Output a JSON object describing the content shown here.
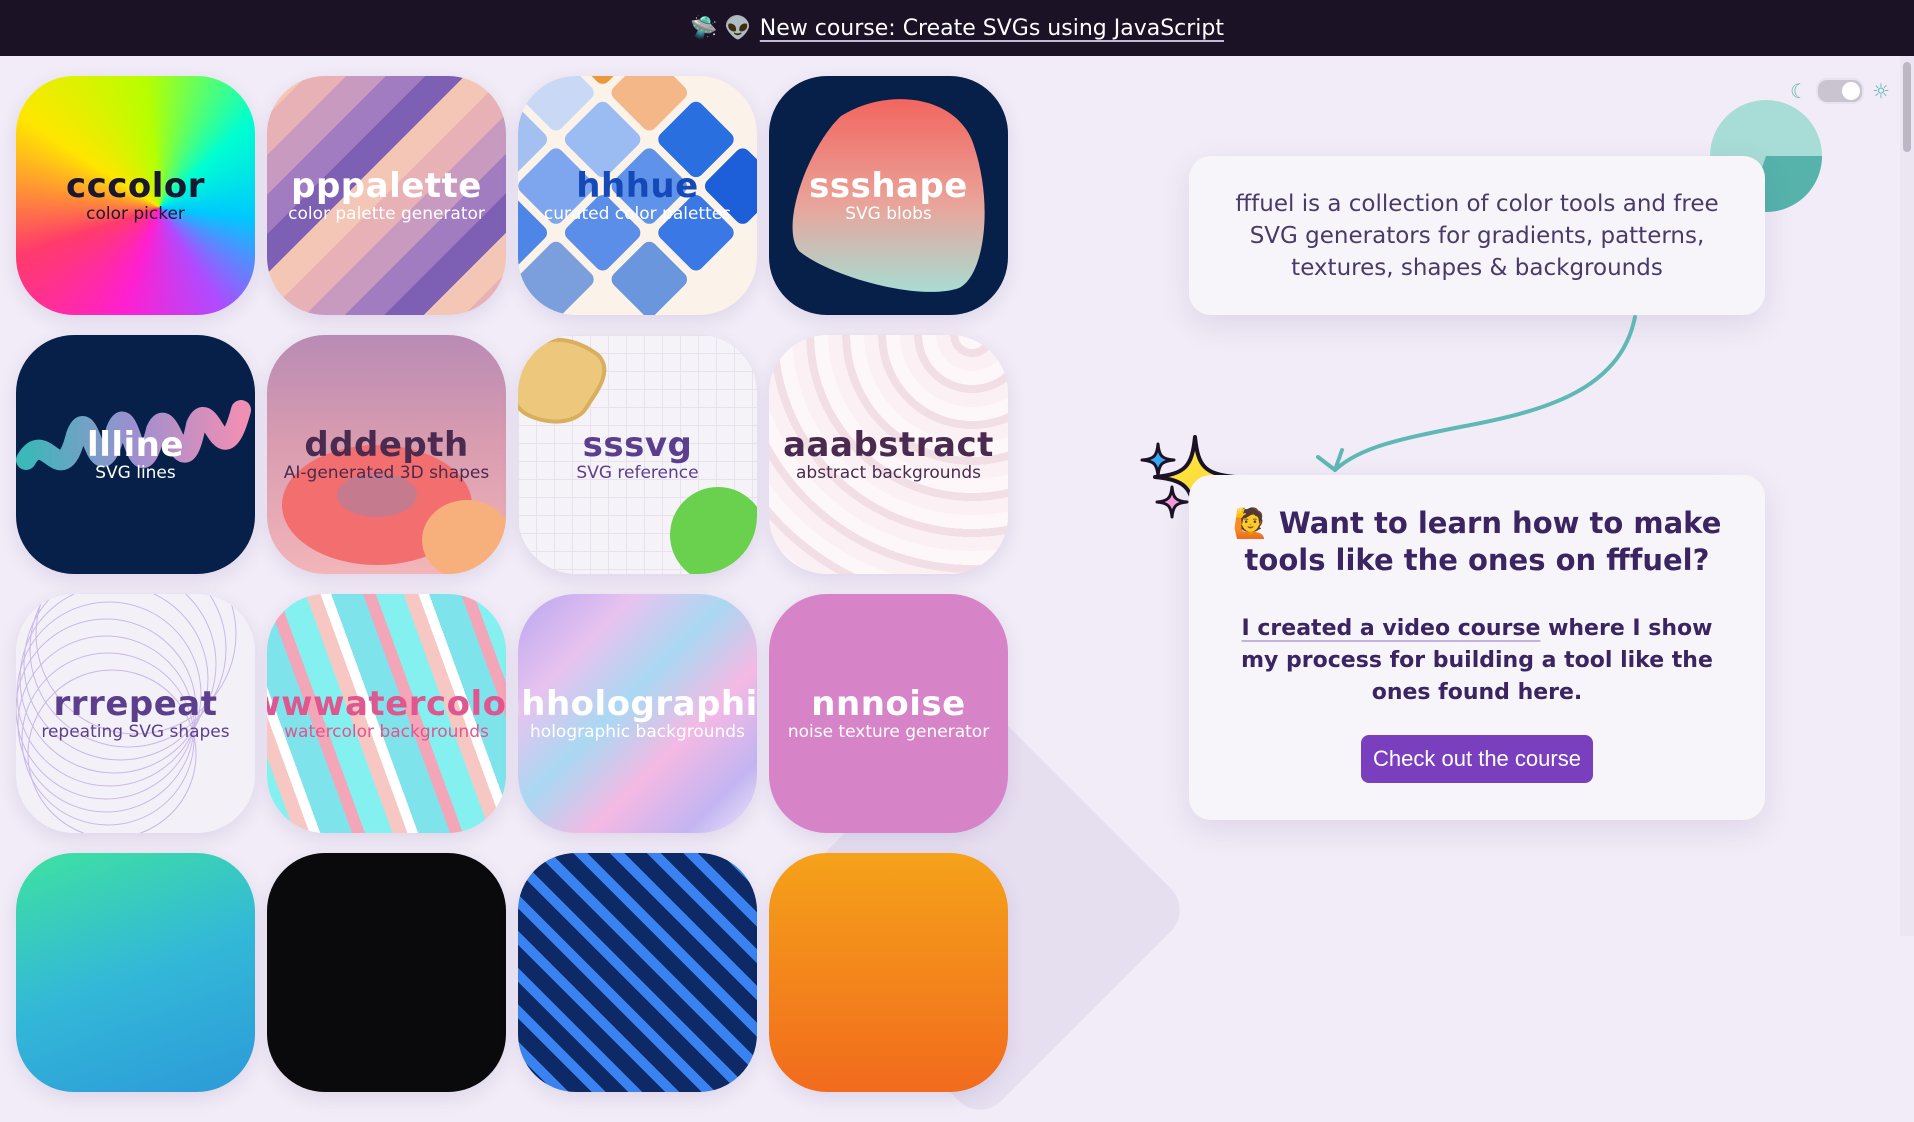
{
  "banner": {
    "emoji": "🛸 👽",
    "link": "New course: Create SVGs using JavaScript"
  },
  "theme_toggle": {
    "moon_icon": "☾",
    "sun_icon": "☼",
    "state": "dark-off"
  },
  "tiles": [
    {
      "name": "cccolor",
      "sub": "color picker"
    },
    {
      "name": "pppalette",
      "sub": "color palette generator"
    },
    {
      "name": "hhhue",
      "sub": "curated color palettes"
    },
    {
      "name": "ssshape",
      "sub": "SVG blobs"
    },
    {
      "name": "llline",
      "sub": "SVG lines"
    },
    {
      "name": "dddepth",
      "sub": "AI-generated 3D shapes"
    },
    {
      "name": "sssvg",
      "sub": "SVG reference"
    },
    {
      "name": "aaabstract",
      "sub": "abstract backgrounds"
    },
    {
      "name": "rrrepeat",
      "sub": "repeating SVG shapes"
    },
    {
      "name": "wwwatercolor",
      "sub": "watercolor backgrounds"
    },
    {
      "name": "hhholographic",
      "sub": "holographic backgrounds"
    },
    {
      "name": "nnnoise",
      "sub": "noise texture generator"
    },
    {
      "name": "",
      "sub": ""
    },
    {
      "name": "",
      "sub": ""
    },
    {
      "name": "",
      "sub": ""
    },
    {
      "name": "",
      "sub": ""
    }
  ],
  "intro": {
    "text": "fffuel is a collection of color tools and free SVG generators for gradients, patterns, textures, shapes & backgrounds"
  },
  "course": {
    "emoji": "🙋",
    "heading": "Want to learn how to make tools like the ones on fffuel?",
    "link": "I created a video course",
    "body_rest": " where I show my process for building a tool like the ones found here.",
    "cta": "Check out the course"
  }
}
